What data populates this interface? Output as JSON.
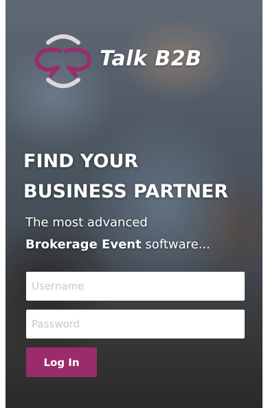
{
  "brand": {
    "name": "Talk B2B",
    "logo_colors": {
      "arc": "#d9d9d9",
      "accent": "#9b2c6b"
    }
  },
  "hero": {
    "headline_line1": "FIND YOUR",
    "headline_line2": "BUSINESS PARTNER",
    "subline1": "The most advanced",
    "subline2_bold": "Brokerage Event",
    "subline2_rest": " software..."
  },
  "form": {
    "username_placeholder": "Username",
    "password_placeholder": "Password",
    "login_label": "Log In",
    "login_color": "#9b2c6b"
  }
}
